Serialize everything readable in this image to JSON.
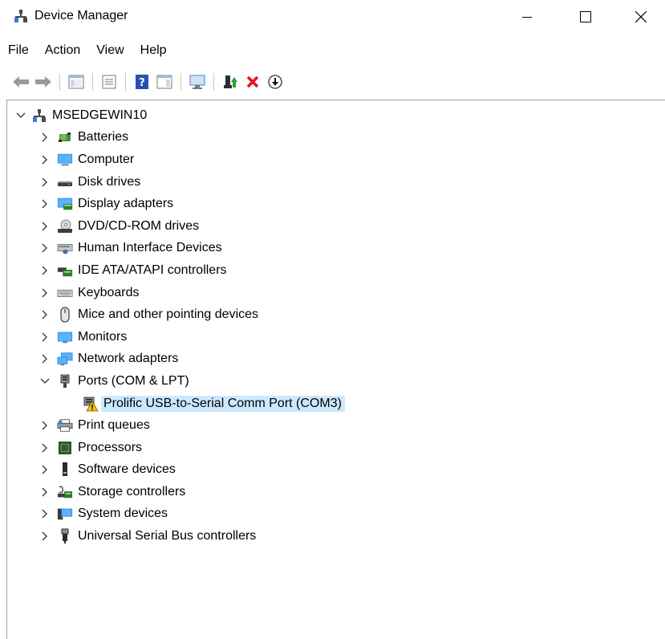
{
  "window": {
    "title": "Device Manager"
  },
  "menu": [
    "File",
    "Action",
    "View",
    "Help"
  ],
  "toolbar": {
    "buttons": [
      "back",
      "forward",
      "show-hide-console-tree",
      "properties",
      "help",
      "action-pane",
      "scan-hardware",
      "update-driver",
      "uninstall",
      "disable"
    ]
  },
  "tree": {
    "root": "MSEDGEWIN10",
    "categories": [
      {
        "label": "Batteries"
      },
      {
        "label": "Computer"
      },
      {
        "label": "Disk drives"
      },
      {
        "label": "Display adapters"
      },
      {
        "label": "DVD/CD-ROM drives"
      },
      {
        "label": "Human Interface Devices"
      },
      {
        "label": "IDE ATA/ATAPI controllers"
      },
      {
        "label": "Keyboards"
      },
      {
        "label": "Mice and other pointing devices"
      },
      {
        "label": "Monitors"
      },
      {
        "label": "Network adapters"
      },
      {
        "label": "Ports (COM & LPT)",
        "expanded": true
      },
      {
        "label": "Print queues"
      },
      {
        "label": "Processors"
      },
      {
        "label": "Software devices"
      },
      {
        "label": "Storage controllers"
      },
      {
        "label": "System devices"
      },
      {
        "label": "Universal Serial Bus controllers"
      }
    ],
    "ports_children": [
      {
        "label": "Prolific USB-to-Serial Comm Port (COM3)",
        "status": "warning",
        "selected": true
      }
    ]
  },
  "colors": {
    "selection": "#cce8ff",
    "warning": "#f5c400",
    "error_x": "#e81123",
    "accent": "#0078d7"
  }
}
